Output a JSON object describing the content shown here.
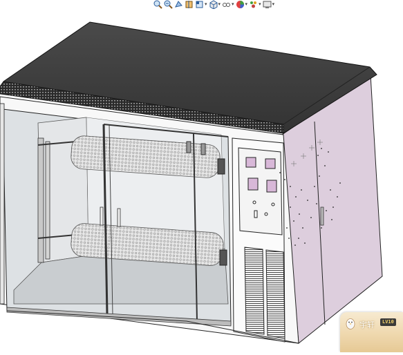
{
  "toolbar": {
    "items": [
      {
        "icon": "zoom-fit-icon"
      },
      {
        "icon": "zoom-area-icon"
      },
      {
        "icon": "previous-view-icon"
      },
      {
        "icon": "section-view-icon"
      },
      {
        "icon": "view-orientation-icon",
        "dropdown": true
      },
      {
        "icon": "display-style-icon",
        "dropdown": true
      },
      {
        "icon": "hide-show-items-icon",
        "dropdown": true
      },
      {
        "icon": "edit-appearance-icon",
        "dropdown": true
      },
      {
        "icon": "apply-scene-icon",
        "dropdown": true
      },
      {
        "icon": "view-settings-icon",
        "dropdown": true
      }
    ],
    "dropdown_glyph": "▾"
  },
  "notification": {
    "name": "宇轩",
    "level": "LV10",
    "colors": {
      "accent": "#f4d36b",
      "background": "#efd8ae"
    }
  },
  "colors": {
    "cabinet_side": "#ddcedd",
    "cabinet_front": "#fafafa",
    "top_panel": "#3c3c3c",
    "glass": "#d9dde0"
  }
}
